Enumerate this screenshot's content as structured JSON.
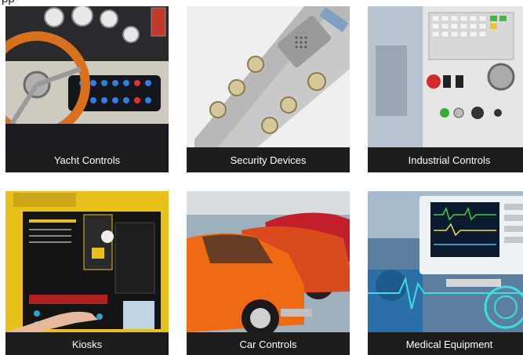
{
  "heading": "pp",
  "tiles": [
    {
      "label": "Yacht Controls",
      "icon": "yacht-helm-image"
    },
    {
      "label": "Security Devices",
      "icon": "intercom-panel-image"
    },
    {
      "label": "Industrial Controls",
      "icon": "cnc-control-panel-image"
    },
    {
      "label": "Kiosks",
      "icon": "kiosk-image"
    },
    {
      "label": "Car Controls",
      "icon": "classic-cars-image"
    },
    {
      "label": "Medical Equipment",
      "icon": "medical-monitor-image"
    }
  ],
  "colors": {
    "caption_bg": "#1c1c1c",
    "caption_text": "#ffffff"
  }
}
